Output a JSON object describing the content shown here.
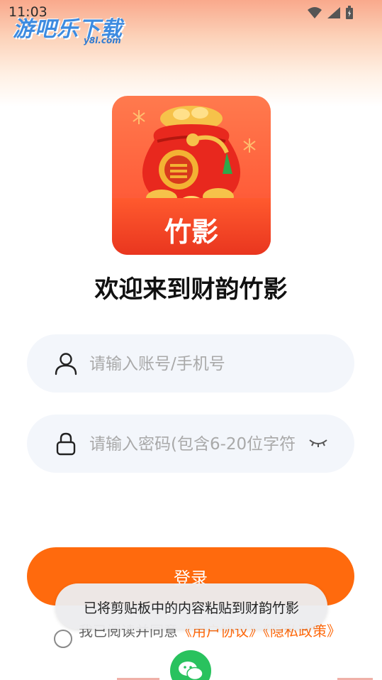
{
  "status_bar": {
    "time": "11:03"
  },
  "watermark": {
    "title": "游吧乐下载",
    "subtitle": "y8l.com"
  },
  "logo": {
    "text": "竹影"
  },
  "welcome": {
    "title": "欢迎来到财韵竹影"
  },
  "account_field": {
    "placeholder": "请输入账号/手机号",
    "value": ""
  },
  "password_field": {
    "placeholder": "请输入密码(包含6-20位字符",
    "value": ""
  },
  "login_button": {
    "label": "登录"
  },
  "agreement": {
    "prefix": "我已阅读并同意",
    "user_agreement": "《用户协议》",
    "privacy_policy": "《隐私政策》"
  },
  "toast": {
    "message": "已将剪贴板中的内容粘贴到财韵竹影"
  },
  "colors": {
    "accent": "#ff6a0d",
    "wechat": "#29c25e"
  },
  "icons": {
    "account": "user-icon",
    "password": "lock-icon",
    "toggle": "eye-closed-icon",
    "wechat": "wechat-icon"
  }
}
